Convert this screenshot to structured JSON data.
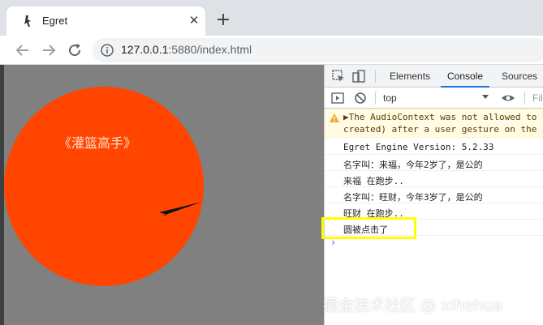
{
  "browser": {
    "tab_title": "Egret",
    "tab_close": "✕",
    "new_tab": "+",
    "url_host": "127.0.0.1",
    "url_path": ":5880/index.html"
  },
  "stage": {
    "title_text": "《灌篮高手》",
    "circle_color": "#ff4500",
    "background_color": "#808080"
  },
  "devtools": {
    "tabs": [
      "Elements",
      "Console",
      "Sources"
    ],
    "active_tab": "Console",
    "context": "top",
    "filter_placeholder": "Fil",
    "warning_line1": "▶The AudioContext was not allowed to",
    "warning_line2": "created) after a user gesture on the p",
    "logs": [
      "Egret Engine Version: 5.2.33",
      "名字叫：来福，今年2岁了，是公的",
      "来福 在跑步..",
      "名字叫：旺财，今年3岁了，是公的",
      "旺财 在跑步..",
      "圆被点击了"
    ],
    "prompt": "›"
  },
  "watermark": "掘金技术社区 @ xihehua"
}
